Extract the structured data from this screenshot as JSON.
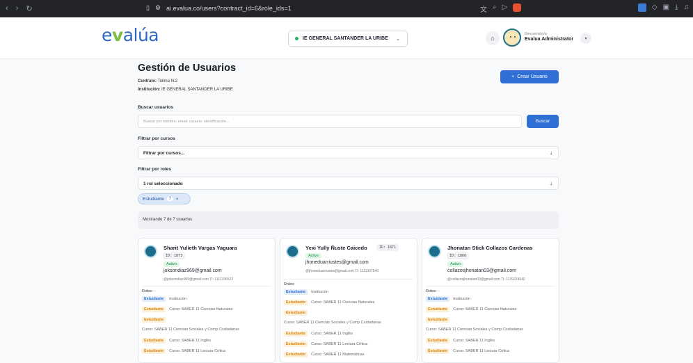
{
  "browser": {
    "url": "ai.evalua.co/users?contract_id=6&role_ids=1"
  },
  "header": {
    "logo_pre": "e",
    "logo_v": "v",
    "logo_post": "alúa",
    "institution": "IE GENERAL SANTANDER LA URIBE",
    "welcome": "Bienvenido/a",
    "user": "Evalua Administrator"
  },
  "page": {
    "title": "Gestión de Usuarios",
    "contract_label": "Contrato:",
    "contract": "Tolima N.2",
    "institution_label": "Institución:",
    "institution": "IE GENERAL SANTANDER LA URIBE",
    "create_label": "Crear Usuario"
  },
  "search": {
    "label": "Buscar usuarios",
    "placeholder": "Buscar por nombre, email, usuario, identificación...",
    "button": "Buscar"
  },
  "courses": {
    "label": "Filtrar por cursos",
    "value": "Filtrar por cursos..."
  },
  "roles": {
    "label": "Filtrar por roles",
    "value": "1 rol seleccionado"
  },
  "chip": {
    "label": "Estudiante",
    "count": "7"
  },
  "showing": "Mostrando 7 de 7 usuarios",
  "roles_label": "Roles:",
  "cards": [
    {
      "name": "Sharit Yulieth Vargas Yaguara",
      "id": "ID: 1873",
      "status": "Activo",
      "email": "joksondiaz969@gmail.com",
      "sub": "@joksondiaz969@gmail.com   TI: 1111336522",
      "roles": [
        [
          "Estudiante",
          "Institución",
          "blue"
        ],
        [
          "Estudiante",
          "Curso: SABER 11 Ciencias Naturales",
          "orange"
        ],
        [
          "Estudiante",
          "",
          "orange"
        ],
        [
          "",
          "Curso: SABER 11 Ciencias Sociales y Comp Ciudadanas",
          ""
        ],
        [
          "Estudiante",
          "Curso: SABER 11 Inglés",
          "orange"
        ],
        [
          "Estudiante",
          "Curso: SABER 11 Lectura Crítica",
          "orange"
        ]
      ]
    },
    {
      "name": "Yexi Yully Ñuste Caicedo",
      "id": "ID: 1871",
      "status": "Activo",
      "email": "jhoneduarriustes@gmail.com",
      "sub": "@jhoneduarriustes@gmail.com   TI: 1111337540",
      "roles": [
        [
          "Estudiante",
          "Institución",
          "blue"
        ],
        [
          "Estudiante",
          "Curso: SABER 11 Ciencias Naturales",
          "orange"
        ],
        [
          "Estudiante",
          "",
          "orange"
        ],
        [
          "",
          "Curso: SABER 11 Ciencias Sociales y Comp Ciudadanas",
          ""
        ],
        [
          "Estudiante",
          "Curso: SABER 11 Inglés",
          "orange"
        ],
        [
          "Estudiante",
          "Curso: SABER 11 Lectura Crítica",
          "orange"
        ],
        [
          "Estudiante",
          "Curso: SABER 11 Matemáticas",
          "orange"
        ]
      ]
    },
    {
      "name": "Jhonatan Stick Collazos Cardenas",
      "id": "ID: 1866",
      "status": "Activo",
      "email": "collazosjhonatan03@gmail.com",
      "sub": "@collazosjhonatan03@gmail.com   TI: 1139224540",
      "roles": [
        [
          "Estudiante",
          "Institución",
          "blue"
        ],
        [
          "Estudiante",
          "Curso: SABER 11 Ciencias Naturales",
          "orange"
        ],
        [
          "Estudiante",
          "",
          "orange"
        ],
        [
          "",
          "Curso: SABER 11 Ciencias Sociales y Comp Ciudadanas",
          ""
        ],
        [
          "Estudiante",
          "Curso: SABER 11 Inglés",
          "orange"
        ],
        [
          "Estudiante",
          "Curso: SABER 11 Lectura Crítica",
          "orange"
        ]
      ]
    }
  ]
}
